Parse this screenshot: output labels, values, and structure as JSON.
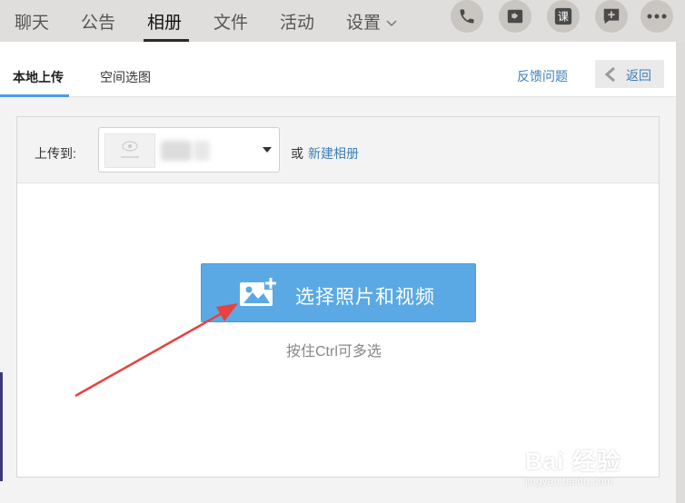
{
  "nav": {
    "tabs": [
      {
        "label": "聊天"
      },
      {
        "label": "公告"
      },
      {
        "label": "相册"
      },
      {
        "label": "文件"
      },
      {
        "label": "活动"
      },
      {
        "label": "设置"
      }
    ],
    "active_tab": "相册",
    "actions": [
      {
        "icon": "phone-icon"
      },
      {
        "icon": "video-icon"
      },
      {
        "icon": "course-icon",
        "label": "课"
      },
      {
        "icon": "comment-add-icon"
      },
      {
        "icon": "more-icon"
      }
    ]
  },
  "subtabs": {
    "items": [
      {
        "label": "本地上传"
      },
      {
        "label": "空间选图"
      }
    ],
    "active": "本地上传",
    "feedback": "反馈问题",
    "back": "返回"
  },
  "upload": {
    "upload_to_label": "上传到:",
    "or_text": "或",
    "new_album": "新建相册",
    "select_button": "选择照片和视频",
    "hint": "按住Ctrl可多选"
  },
  "watermark": {
    "brand": "Bai 经验",
    "site": "jingyan.baidu.com"
  },
  "colors": {
    "accent": "#4a9ee8",
    "button": "#5aa9e5",
    "link": "#3f7fb8",
    "annotation": "#e8413f"
  }
}
